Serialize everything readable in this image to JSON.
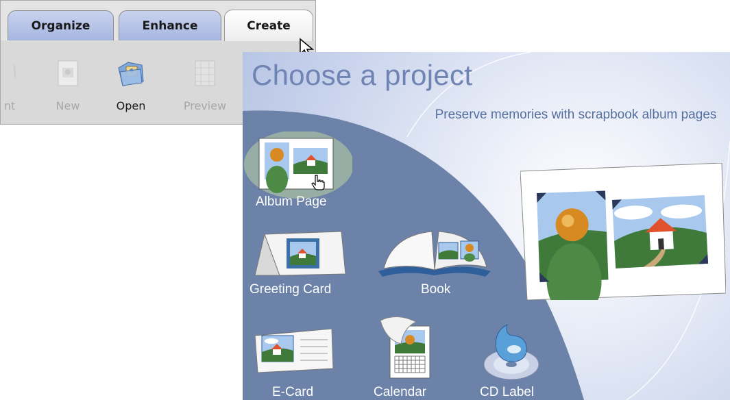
{
  "tabs": [
    {
      "label": "Organize"
    },
    {
      "label": "Enhance"
    },
    {
      "label": "Create"
    }
  ],
  "toolbar": {
    "partial_label": "nt",
    "new_label": "New",
    "open_label": "Open",
    "preview_label": "Preview"
  },
  "panel": {
    "title": "Choose a project",
    "description": "Preserve memories with scrapbook album pages"
  },
  "projects": [
    {
      "label": "Album Page"
    },
    {
      "label": "Greeting Card"
    },
    {
      "label": "Book"
    },
    {
      "label": "E-Card"
    },
    {
      "label": "Calendar"
    },
    {
      "label": "CD Label"
    }
  ],
  "colors": {
    "tab_inactive": "#b3c1e7",
    "panel_title": "#6f84b3",
    "project_area": "#6c82a8",
    "label_text": "#ffffff"
  }
}
